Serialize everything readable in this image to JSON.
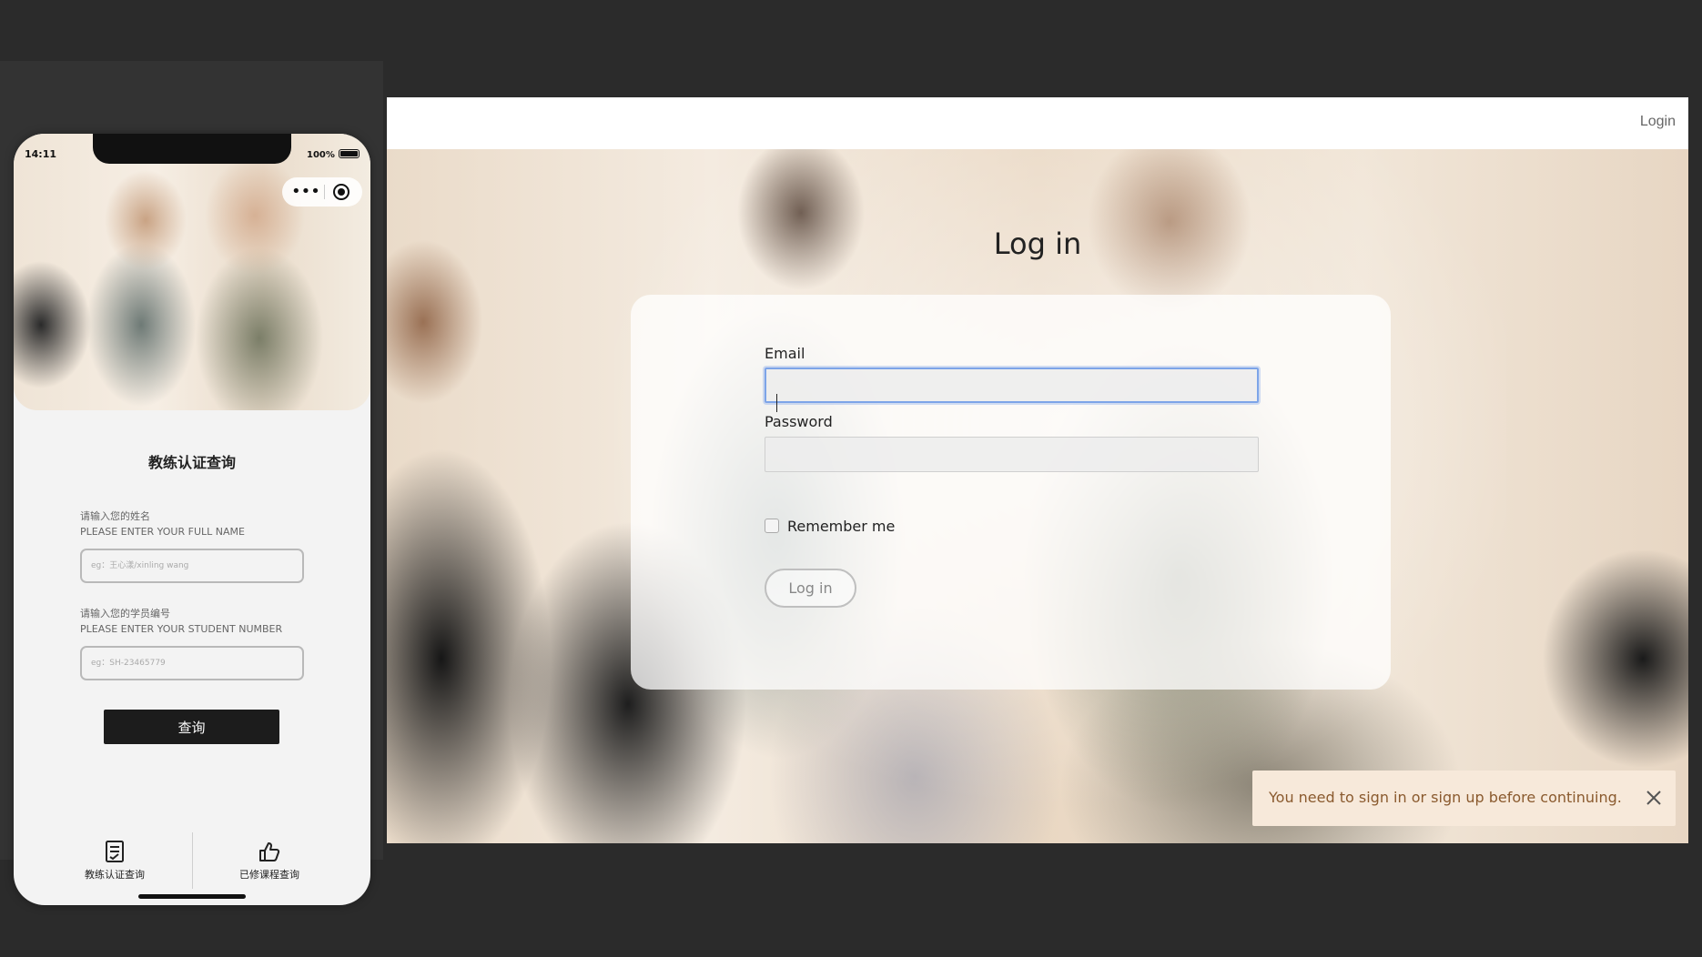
{
  "phone": {
    "status_time": "14:11",
    "battery_percent": "100%",
    "capsule_more_icon": "more-dots-icon",
    "capsule_target_icon": "target-icon",
    "title": "教练认证查询",
    "name_label_cn": "请输入您的姓名",
    "name_label_en": "PLEASE ENTER YOUR FULL NAME",
    "name_placeholder": "eg：王心漾/xinling wang",
    "number_label_cn": "请输入您的学员编号",
    "number_label_en": "PLEASE ENTER YOUR STUDENT NUMBER",
    "number_placeholder": "eg：SH-23465779",
    "query_button": "查询",
    "tabs": [
      {
        "label": "教练认证查询",
        "icon": "checklist-icon"
      },
      {
        "label": "已修课程查询",
        "icon": "thumbs-up-icon"
      }
    ]
  },
  "web": {
    "nav_login": "Login",
    "title": "Log in",
    "email_label": "Email",
    "email_value": "",
    "password_label": "Password",
    "password_value": "",
    "remember_label": "Remember me",
    "remember_checked": false,
    "login_button": "Log in",
    "flash_message": "You need to sign in or sign up before continuing.",
    "flash_close_icon": "close-icon"
  }
}
